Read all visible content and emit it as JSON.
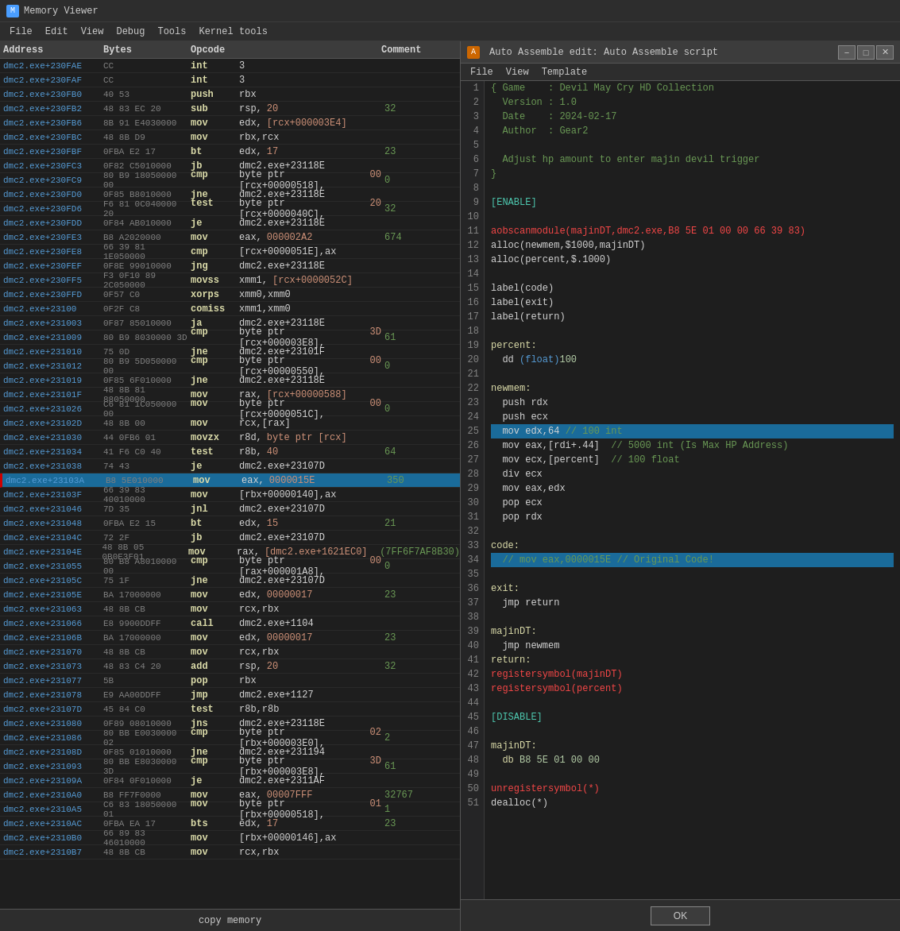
{
  "titleBar": {
    "title": "Memory Viewer",
    "icon": "M"
  },
  "menuItems": [
    "File",
    "Edit",
    "View",
    "Debug",
    "Tools",
    "Kernel tools"
  ],
  "tableHeaders": {
    "address": "Address",
    "bytes": "Bytes",
    "opcode": "Opcode",
    "comment": "Comment"
  },
  "rows": [
    {
      "address": "dmc2.exe+230FAE",
      "bytes": "CC",
      "mnemonic": "int",
      "op1": "3",
      "op2": "",
      "comment": ""
    },
    {
      "address": "dmc2.exe+230FAF",
      "bytes": "CC",
      "mnemonic": "int",
      "op1": "3",
      "op2": "",
      "comment": ""
    },
    {
      "address": "dmc2.exe+230FB0",
      "bytes": "40 53",
      "mnemonic": "push",
      "op1": "rbx",
      "op2": "",
      "comment": ""
    },
    {
      "address": "dmc2.exe+230FB2",
      "bytes": "48 83 EC 20",
      "mnemonic": "sub",
      "op1": "rsp,",
      "op2": "20",
      "comment": "32"
    },
    {
      "address": "dmc2.exe+230FB6",
      "bytes": "8B 91 E4030000",
      "mnemonic": "mov",
      "op1": "edx,",
      "op2": "[rcx+000003E4]",
      "comment": ""
    },
    {
      "address": "dmc2.exe+230FBC",
      "bytes": "48 8B D9",
      "mnemonic": "mov",
      "op1": "rbx,rcx",
      "op2": "",
      "comment": ""
    },
    {
      "address": "dmc2.exe+230FBF",
      "bytes": "0FBA E2 17",
      "mnemonic": "bt",
      "op1": "edx,",
      "op2": "17",
      "comment": "23"
    },
    {
      "address": "dmc2.exe+230FC3",
      "bytes": "0F82 C5010000",
      "mnemonic": "jb",
      "op1": "dmc2.exe+23118E",
      "op2": "",
      "comment": ""
    },
    {
      "address": "dmc2.exe+230FC9",
      "bytes": "80 B9 18050000 00",
      "mnemonic": "cmp",
      "op1": "byte ptr [rcx+00000518],",
      "op2": "00",
      "comment": "0"
    },
    {
      "address": "dmc2.exe+230FD0",
      "bytes": "0F85 B8010000",
      "mnemonic": "jne",
      "op1": "dmc2.exe+23118E",
      "op2": "",
      "comment": ""
    },
    {
      "address": "dmc2.exe+230FD6",
      "bytes": "F6 81 0C040000 20",
      "mnemonic": "test",
      "op1": "byte ptr [rcx+0000040C],",
      "op2": "20",
      "comment": "32"
    },
    {
      "address": "dmc2.exe+230FDD",
      "bytes": "0F84 AB010000",
      "mnemonic": "je",
      "op1": "dmc2.exe+23118E",
      "op2": "",
      "comment": ""
    },
    {
      "address": "dmc2.exe+230FE3",
      "bytes": "B8 A2020000",
      "mnemonic": "mov",
      "op1": "eax,",
      "op2": "000002A2",
      "comment": "674"
    },
    {
      "address": "dmc2.exe+230FE8",
      "bytes": "66 39 81 1E050000",
      "mnemonic": "cmp",
      "op1": "[rcx+0000051E],ax",
      "op2": "",
      "comment": ""
    },
    {
      "address": "dmc2.exe+230FEF",
      "bytes": "0F8E 99010000",
      "mnemonic": "jng",
      "op1": "dmc2.exe+23118E",
      "op2": "",
      "comment": ""
    },
    {
      "address": "dmc2.exe+230FF5",
      "bytes": "F3 0F10 89 2C050000",
      "mnemonic": "movss",
      "op1": "xmm1,",
      "op2": "[rcx+0000052C]",
      "comment": ""
    },
    {
      "address": "dmc2.exe+230FFD",
      "bytes": "0F57 C0",
      "mnemonic": "xorps",
      "op1": "xmm0,xmm0",
      "op2": "",
      "comment": ""
    },
    {
      "address": "dmc2.exe+23100",
      "bytes": "0F2F C8",
      "mnemonic": "comiss",
      "op1": "xmm1,xmm0",
      "op2": "",
      "comment": ""
    },
    {
      "address": "dmc2.exe+231003",
      "bytes": "0F87 85010000",
      "mnemonic": "ja",
      "op1": "dmc2.exe+23118E",
      "op2": "",
      "comment": ""
    },
    {
      "address": "dmc2.exe+231009",
      "bytes": "80 B9 8030000 3D",
      "mnemonic": "cmp",
      "op1": "byte ptr [rcx+000003E8],",
      "op2": "3D",
      "comment": "61"
    },
    {
      "address": "dmc2.exe+231010",
      "bytes": "75 0D",
      "mnemonic": "jne",
      "op1": "dmc2.exe+23101F",
      "op2": "",
      "comment": ""
    },
    {
      "address": "dmc2.exe+231012",
      "bytes": "80 B9 5D050000 00",
      "mnemonic": "cmp",
      "op1": "byte ptr [rcx+00000550],",
      "op2": "00",
      "comment": "0"
    },
    {
      "address": "dmc2.exe+231019",
      "bytes": "0F85 6F010000",
      "mnemonic": "jne",
      "op1": "dmc2.exe+23118E",
      "op2": "",
      "comment": ""
    },
    {
      "address": "dmc2.exe+23101F",
      "bytes": "48 8B 81 88050000",
      "mnemonic": "mov",
      "op1": "rax,",
      "op2": "[rcx+00000588]",
      "comment": ""
    },
    {
      "address": "dmc2.exe+231026",
      "bytes": "C6 81 1C050000 00",
      "mnemonic": "mov",
      "op1": "byte ptr [rcx+0000051C],",
      "op2": "00",
      "comment": "0"
    },
    {
      "address": "dmc2.exe+23102D",
      "bytes": "48 8B 00",
      "mnemonic": "mov",
      "op1": "rcx,[rax]",
      "op2": "",
      "comment": ""
    },
    {
      "address": "dmc2.exe+231030",
      "bytes": "44 0FB6 01",
      "mnemonic": "movzx",
      "op1": "r8d,",
      "op2": "byte ptr [rcx]",
      "comment": ""
    },
    {
      "address": "dmc2.exe+231034",
      "bytes": "41 F6 C0 40",
      "mnemonic": "test",
      "op1": "r8b,",
      "op2": "40",
      "comment": "64"
    },
    {
      "address": "dmc2.exe+231038",
      "bytes": "74 43",
      "mnemonic": "je",
      "op1": "dmc2.exe+23107D",
      "op2": "",
      "comment": ""
    },
    {
      "address": "dmc2.exe+23103A",
      "bytes": "B8 5E010000",
      "mnemonic": "mov",
      "op1": "eax,",
      "op2": "0000015E",
      "comment": "350",
      "selected": true
    },
    {
      "address": "dmc2.exe+23103F",
      "bytes": "66 39 83 40010000",
      "mnemonic": "mov",
      "op1": "[rbx+00000140],ax",
      "op2": "",
      "comment": ""
    },
    {
      "address": "dmc2.exe+231046",
      "bytes": "7D 35",
      "mnemonic": "jnl",
      "op1": "dmc2.exe+23107D",
      "op2": "",
      "comment": ""
    },
    {
      "address": "dmc2.exe+231048",
      "bytes": "0FBA E2 15",
      "mnemonic": "bt",
      "op1": "edx,",
      "op2": "15",
      "comment": "21"
    },
    {
      "address": "dmc2.exe+23104C",
      "bytes": "72 2F",
      "mnemonic": "jb",
      "op1": "dmc2.exe+23107D",
      "op2": "",
      "comment": ""
    },
    {
      "address": "dmc2.exe+23104E",
      "bytes": "48 8B 05 0B0E3F01",
      "mnemonic": "mov",
      "op1": "rax,",
      "op2": "[dmc2.exe+1621EC0]",
      "comment": "(7FF6F7AF8B30)"
    },
    {
      "address": "dmc2.exe+231055",
      "bytes": "80 B8 A8010000 00",
      "mnemonic": "cmp",
      "op1": "byte ptr [rax+000001A8],",
      "op2": "00",
      "comment": "0"
    },
    {
      "address": "dmc2.exe+23105C",
      "bytes": "75 1F",
      "mnemonic": "jne",
      "op1": "dmc2.exe+23107D",
      "op2": "",
      "comment": ""
    },
    {
      "address": "dmc2.exe+23105E",
      "bytes": "BA 17000000",
      "mnemonic": "mov",
      "op1": "edx,",
      "op2": "00000017",
      "comment": "23"
    },
    {
      "address": "dmc2.exe+231063",
      "bytes": "48 8B CB",
      "mnemonic": "mov",
      "op1": "rcx,rbx",
      "op2": "",
      "comment": ""
    },
    {
      "address": "dmc2.exe+231066",
      "bytes": "E8 9900DDFF",
      "mnemonic": "call",
      "op1": "dmc2.exe+1104",
      "op2": "",
      "comment": ""
    },
    {
      "address": "dmc2.exe+23106B",
      "bytes": "BA 17000000",
      "mnemonic": "mov",
      "op1": "edx,",
      "op2": "00000017",
      "comment": "23"
    },
    {
      "address": "dmc2.exe+231070",
      "bytes": "48 8B CB",
      "mnemonic": "mov",
      "op1": "rcx,rbx",
      "op2": "",
      "comment": ""
    },
    {
      "address": "dmc2.exe+231073",
      "bytes": "48 83 C4 20",
      "mnemonic": "add",
      "op1": "rsp,",
      "op2": "20",
      "comment": "32"
    },
    {
      "address": "dmc2.exe+231077",
      "bytes": "5B",
      "mnemonic": "pop",
      "op1": "rbx",
      "op2": "",
      "comment": ""
    },
    {
      "address": "dmc2.exe+231078",
      "bytes": "E9 AA00DDFF",
      "mnemonic": "jmp",
      "op1": "dmc2.exe+1127",
      "op2": "",
      "comment": ""
    },
    {
      "address": "dmc2.exe+23107D",
      "bytes": "45 84 C0",
      "mnemonic": "test",
      "op1": "r8b,r8b",
      "op2": "",
      "comment": ""
    },
    {
      "address": "dmc2.exe+231080",
      "bytes": "0F89 08010000",
      "mnemonic": "jns",
      "op1": "dmc2.exe+23118E",
      "op2": "",
      "comment": ""
    },
    {
      "address": "dmc2.exe+231086",
      "bytes": "80 BB E0030000 02",
      "mnemonic": "cmp",
      "op1": "byte ptr [rbx+000003E0],",
      "op2": "02",
      "comment": "2"
    },
    {
      "address": "dmc2.exe+23108D",
      "bytes": "0F85 01010000",
      "mnemonic": "jne",
      "op1": "dmc2.exe+231194",
      "op2": "",
      "comment": ""
    },
    {
      "address": "dmc2.exe+231093",
      "bytes": "80 BB E8030000 3D",
      "mnemonic": "cmp",
      "op1": "byte ptr [rbx+000003E8],",
      "op2": "3D",
      "comment": "61"
    },
    {
      "address": "dmc2.exe+23109A",
      "bytes": "0F84 0F010000",
      "mnemonic": "je",
      "op1": "dmc2.exe+2311AF",
      "op2": "",
      "comment": ""
    },
    {
      "address": "dmc2.exe+2310A0",
      "bytes": "B8 FF7F0000",
      "mnemonic": "mov",
      "op1": "eax,",
      "op2": "00007FFF",
      "comment": "32767"
    },
    {
      "address": "dmc2.exe+2310A5",
      "bytes": "C6 83 18050000 01",
      "mnemonic": "mov",
      "op1": "byte ptr [rbx+00000518],",
      "op2": "01",
      "comment": "1"
    },
    {
      "address": "dmc2.exe+2310AC",
      "bytes": "0FBA EA 17",
      "mnemonic": "bts",
      "op1": "edx,",
      "op2": "17",
      "comment": "23"
    },
    {
      "address": "dmc2.exe+2310B0",
      "bytes": "66 89 83 46010000",
      "mnemonic": "mov",
      "op1": "[rbx+00000146],ax",
      "op2": "",
      "comment": ""
    },
    {
      "address": "dmc2.exe+2310B7",
      "bytes": "48 8B CB",
      "mnemonic": "mov",
      "op1": "rcx,rbx",
      "op2": "",
      "comment": ""
    }
  ],
  "autoAssemble": {
    "title": "Auto Assemble edit: Auto Assemble script",
    "menuItems": [
      "File",
      "View",
      "Template"
    ],
    "lines": [
      {
        "num": 1,
        "text": "{ Game    : Devil May Cry HD Collection",
        "class": "c-green"
      },
      {
        "num": 2,
        "text": "  Version : 1.0",
        "class": "c-green"
      },
      {
        "num": 3,
        "text": "  Date    : 2024-02-17",
        "class": "c-green"
      },
      {
        "num": 4,
        "text": "  Author  : Gear2",
        "class": "c-green"
      },
      {
        "num": 5,
        "text": "",
        "class": ""
      },
      {
        "num": 6,
        "text": "  Adjust hp amount to enter majin devil trigger",
        "class": "c-green"
      },
      {
        "num": 7,
        "text": "}",
        "class": "c-green"
      },
      {
        "num": 8,
        "text": "",
        "class": ""
      },
      {
        "num": 9,
        "text": "[ENABLE]",
        "class": "c-cyan"
      },
      {
        "num": 10,
        "text": "",
        "class": ""
      },
      {
        "num": 11,
        "text": "aobscanmodule(majinDT,dmc2.exe,B8 5E 01 00 00 66 39 83)",
        "class": "c-red"
      },
      {
        "num": 12,
        "text": "alloc(newmem,$1000,majinDT)",
        "class": "c-white"
      },
      {
        "num": 13,
        "text": "alloc(percent,$.1000)",
        "class": "c-white"
      },
      {
        "num": 14,
        "text": "",
        "class": ""
      },
      {
        "num": 15,
        "text": "label(code)",
        "class": "c-white"
      },
      {
        "num": 16,
        "text": "label(exit)",
        "class": "c-white"
      },
      {
        "num": 17,
        "text": "label(return)",
        "class": "c-white"
      },
      {
        "num": 18,
        "text": "",
        "class": ""
      },
      {
        "num": 19,
        "text": "percent:",
        "class": "c-yellow"
      },
      {
        "num": 20,
        "text": "  dd (float)100",
        "class": "c-white"
      },
      {
        "num": 21,
        "text": "",
        "class": ""
      },
      {
        "num": 22,
        "text": "newmem:",
        "class": "c-yellow"
      },
      {
        "num": 23,
        "text": "  push rdx",
        "class": "c-white"
      },
      {
        "num": 24,
        "text": "  push ecx",
        "class": "c-white"
      },
      {
        "num": 25,
        "text": "  mov edx,64 // 100 int",
        "class": "c-white c-selected",
        "highlighted": true
      },
      {
        "num": 26,
        "text": "  mov eax,[rdi+.44]  // 5000 int (Is Max HP Address)",
        "class": "c-white"
      },
      {
        "num": 27,
        "text": "  mov ecx,[percent]  // 100 float",
        "class": "c-white"
      },
      {
        "num": 28,
        "text": "  div ecx",
        "class": "c-white"
      },
      {
        "num": 29,
        "text": "  mov eax,edx",
        "class": "c-white"
      },
      {
        "num": 30,
        "text": "  pop ecx",
        "class": "c-white"
      },
      {
        "num": 31,
        "text": "  pop rdx",
        "class": "c-white"
      },
      {
        "num": 32,
        "text": "",
        "class": ""
      },
      {
        "num": 33,
        "text": "code:",
        "class": "c-yellow"
      },
      {
        "num": 34,
        "text": "  // mov eax,0000015E // Original Code!",
        "class": "c-comment",
        "highlighted": true
      },
      {
        "num": 35,
        "text": "",
        "class": ""
      },
      {
        "num": 36,
        "text": "exit:",
        "class": "c-yellow"
      },
      {
        "num": 37,
        "text": "  jmp return",
        "class": "c-white"
      },
      {
        "num": 38,
        "text": "",
        "class": ""
      },
      {
        "num": 39,
        "text": "majinDT:",
        "class": "c-yellow"
      },
      {
        "num": 40,
        "text": "  jmp newmem",
        "class": "c-white"
      },
      {
        "num": 41,
        "text": "return:",
        "class": "c-yellow"
      },
      {
        "num": 42,
        "text": "registersymbol(majinDT)",
        "class": "c-red"
      },
      {
        "num": 43,
        "text": "registersymbol(percent)",
        "class": "c-red"
      },
      {
        "num": 44,
        "text": "",
        "class": ""
      },
      {
        "num": 45,
        "text": "[DISABLE]",
        "class": "c-cyan"
      },
      {
        "num": 46,
        "text": "",
        "class": ""
      },
      {
        "num": 47,
        "text": "majinDT:",
        "class": "c-yellow"
      },
      {
        "num": 48,
        "text": "  db B8 5E 01 00 00",
        "class": "c-white"
      },
      {
        "num": 49,
        "text": "",
        "class": ""
      },
      {
        "num": 50,
        "text": "unregistersymbol(*)",
        "class": "c-red"
      },
      {
        "num": 51,
        "text": "dealloc(*)",
        "class": "c-white"
      }
    ],
    "okButton": "OK"
  },
  "bottomBar": {
    "copyMemory": "copy memory"
  }
}
